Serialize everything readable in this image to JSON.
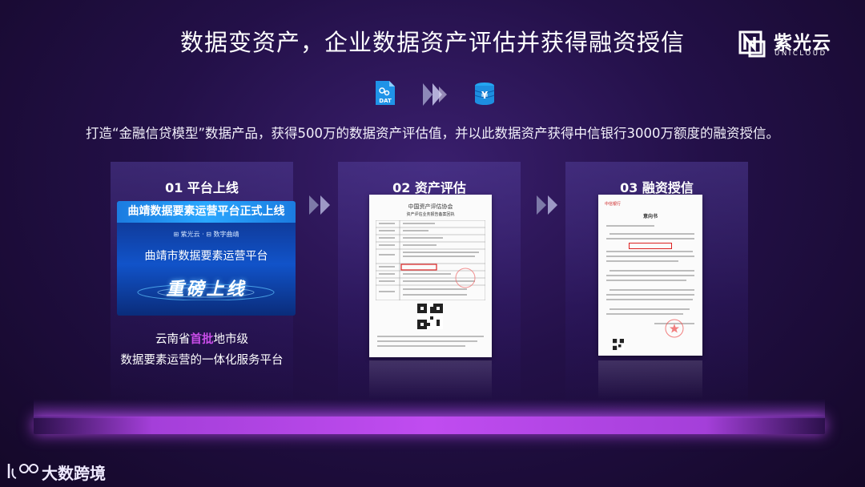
{
  "title": "数据变资产，企业数据资产评估并获得融资授信",
  "brand": {
    "name": "紫光云",
    "sub": "UNICLOUD"
  },
  "icons": {
    "dat_label": "DAT",
    "left": "dat-file-icon",
    "middle": "forward-arrows-icon",
    "right": "coin-stack-icon"
  },
  "description": "打造“金融信贷模型”数据产品，获得500万的数据资产评估值，并以此数据资产获得中信银行3000万额度的融资授信。",
  "steps": [
    {
      "label": "01  平台上线"
    },
    {
      "label": "02  资产评估"
    },
    {
      "label": "03  融资授信"
    }
  ],
  "card1": {
    "header": "曲靖数据要素运营平台正式上线",
    "partners": "⊞ 紫光云  ·  ⊟ 数字曲靖",
    "platform": "曲靖市数据要素运营平台",
    "relaunch": "重磅上线"
  },
  "caption1_pre": "云南省",
  "caption1_hl": "首批",
  "caption1_post": "地市级",
  "caption2": "数据要素运营的一体化服务平台",
  "doc2": {
    "org": "中国资产评估协会",
    "sub": "资产评估业务报告备案回执"
  },
  "doc3": {
    "bank": "中信银行",
    "title": "意向书"
  },
  "footer": {
    "name": "大数跨境"
  },
  "colors": {
    "accent": "#c84de8",
    "background": "#231048"
  }
}
